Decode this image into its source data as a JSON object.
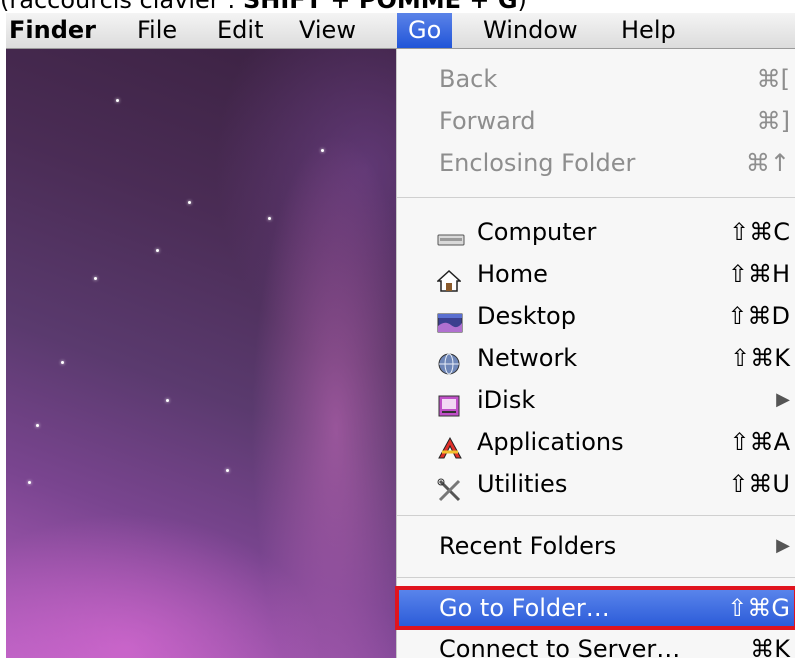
{
  "caption": {
    "prefix": "(raccourcis clavier : ",
    "keys": "SHIFT + POMME + G",
    "suffix": ")"
  },
  "menubar": {
    "app": "Finder",
    "items": [
      "File",
      "Edit",
      "View",
      "Go",
      "Window",
      "Help"
    ],
    "active": "Go"
  },
  "go_menu": {
    "back": {
      "label": "Back",
      "shortcut": "⌘["
    },
    "forward": {
      "label": "Forward",
      "shortcut": "⌘]"
    },
    "enclosing": {
      "label": "Enclosing Folder",
      "shortcut": "⌘↑"
    },
    "computer": {
      "label": "Computer",
      "shortcut": "⇧⌘C",
      "icon": "computer-icon"
    },
    "home": {
      "label": "Home",
      "shortcut": "⇧⌘H",
      "icon": "home-icon"
    },
    "desktop": {
      "label": "Desktop",
      "shortcut": "⇧⌘D",
      "icon": "desktop-icon"
    },
    "network": {
      "label": "Network",
      "shortcut": "⇧⌘K",
      "icon": "network-icon"
    },
    "idisk": {
      "label": "iDisk",
      "submenu": "▶",
      "icon": "idisk-icon"
    },
    "applications": {
      "label": "Applications",
      "shortcut": "⇧⌘A",
      "icon": "applications-icon"
    },
    "utilities": {
      "label": "Utilities",
      "shortcut": "⇧⌘U",
      "icon": "utilities-icon"
    },
    "recent": {
      "label": "Recent Folders",
      "submenu": "▶"
    },
    "goto": {
      "label": "Go to Folder…",
      "shortcut": "⇧⌘G"
    },
    "connect": {
      "label": "Connect to Server…",
      "shortcut": "⌘K"
    }
  },
  "colors": {
    "selection": "#2a5ad8",
    "highlight_border": "#e0141e",
    "disabled_text": "#8e8e8e"
  }
}
